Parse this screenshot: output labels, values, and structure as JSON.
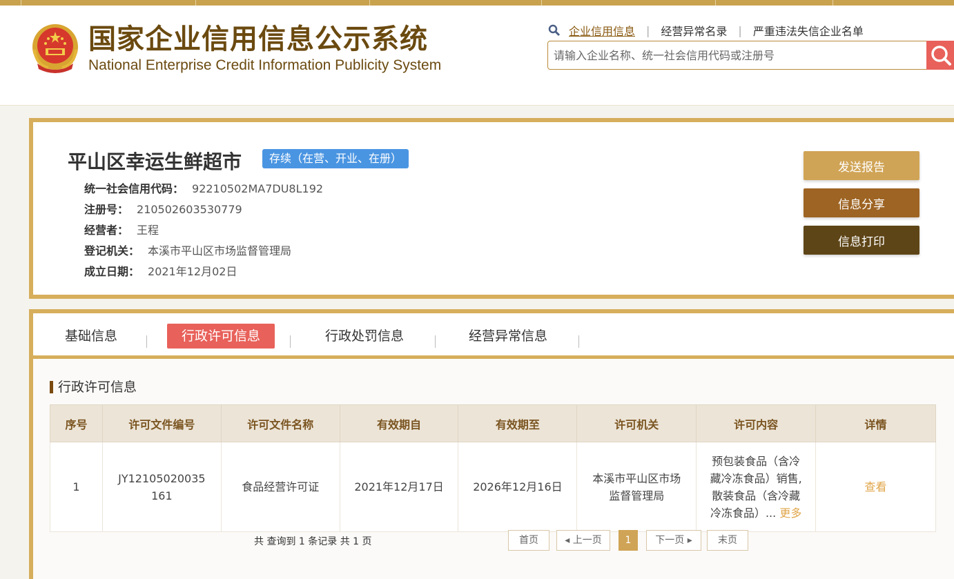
{
  "header": {
    "title_cn": "国家企业信用信息公示系统",
    "title_en": "National Enterprise Credit Information Publicity System",
    "links": [
      "企业信用信息",
      "经营异常名录",
      "严重违法失信企业名单"
    ],
    "search_placeholder": "请输入企业名称、统一社会信用代码或注册号"
  },
  "company": {
    "name": "平山区幸运生鲜超市",
    "status": "存续（在营、开业、在册）",
    "fields": [
      {
        "label": "统一社会信用代码：",
        "value": "92210502MA7DU8L192"
      },
      {
        "label": "注册号：",
        "value": "210502603530779"
      },
      {
        "label": "经营者：",
        "value": "王程"
      },
      {
        "label": "登记机关：",
        "value": "本溪市平山区市场监督管理局"
      },
      {
        "label": "成立日期：",
        "value": "2021年12月02日"
      }
    ],
    "actions": {
      "send": "发送报告",
      "share": "信息分享",
      "print": "信息打印"
    }
  },
  "tabs": [
    "基础信息",
    "行政许可信息",
    "行政处罚信息",
    "经营异常信息"
  ],
  "section": {
    "title": "行政许可信息",
    "columns": [
      "序号",
      "许可文件编号",
      "许可文件名称",
      "有效期自",
      "有效期至",
      "许可机关",
      "许可内容",
      "详情"
    ],
    "rows": [
      {
        "index": "1",
        "doc_no": "JY12105020035161",
        "doc_name": "食品经营许可证",
        "valid_from": "2021年12月17日",
        "valid_to": "2026年12月16日",
        "authority": "本溪市平山区市场监督管理局",
        "content": "预包装食品（含冷藏冷冻食品）销售,散装食品（含冷藏冷冻食品）...",
        "more": "更多",
        "detail": "查看"
      }
    ]
  },
  "pagination": {
    "summary": "共 查询到 1 条记录 共 1 页",
    "first": "首页",
    "prev": "上一页",
    "current": "1",
    "next": "下一页",
    "last": "末页"
  },
  "colors": {
    "gold": "#d6ae5c",
    "accent": "#e8615a",
    "badge": "#4a95e2"
  }
}
